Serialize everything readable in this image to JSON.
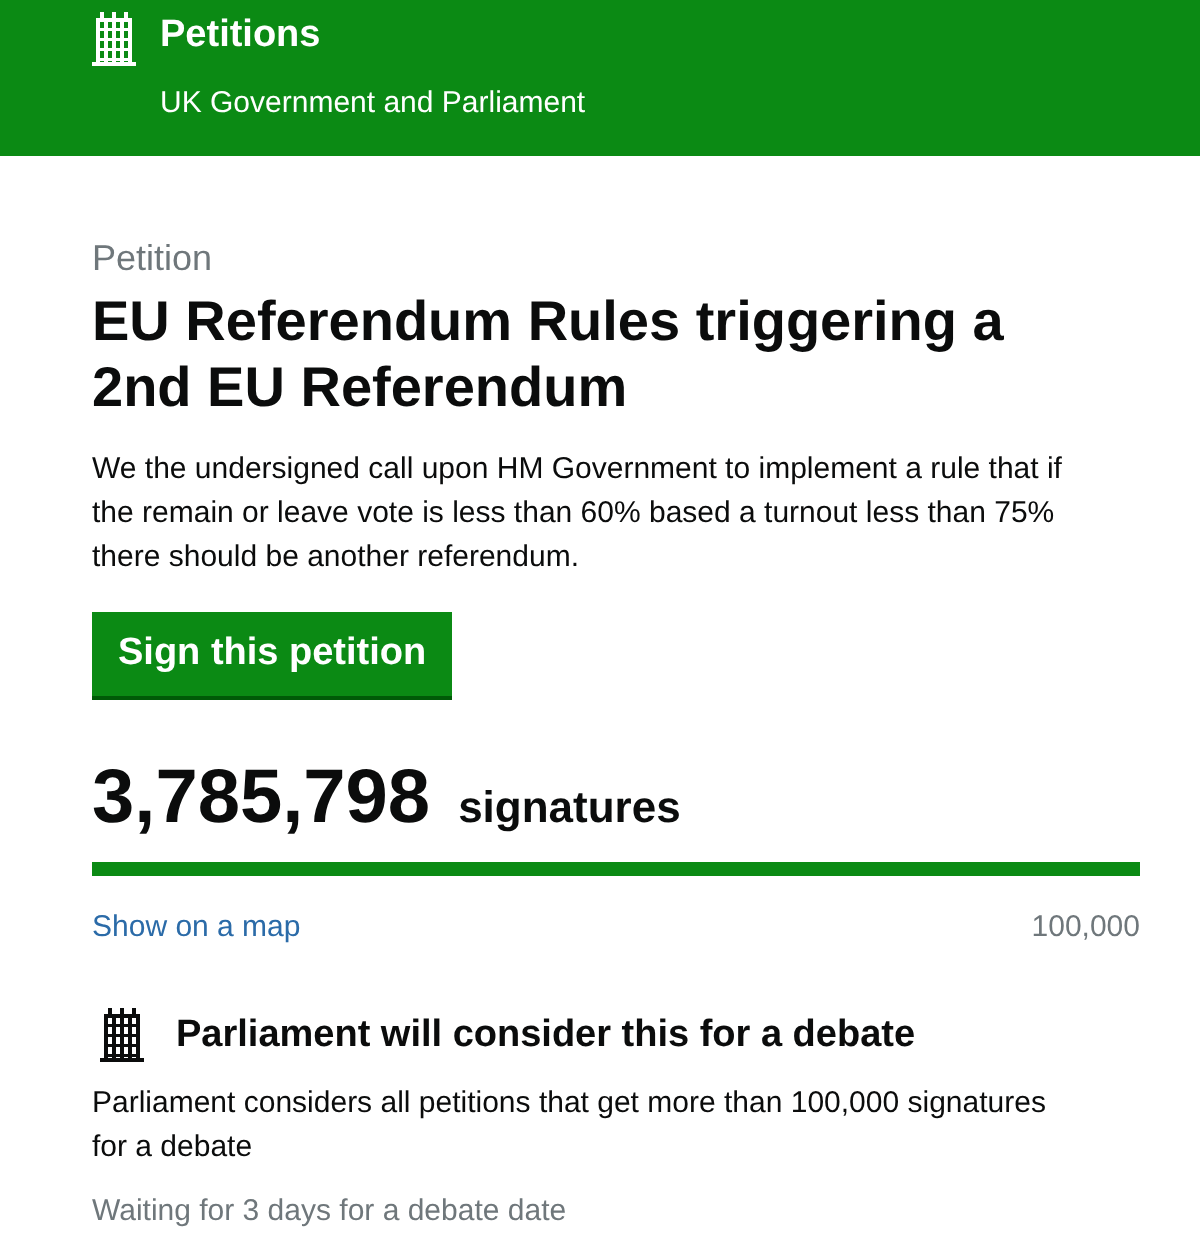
{
  "header": {
    "title": "Petitions",
    "subtitle": "UK Government and Parliament"
  },
  "petition": {
    "label": "Petition",
    "title": "EU Referendum Rules triggering a 2nd EU Referendum",
    "description": "We the undersigned call upon HM Government to implement a rule that if the remain or leave vote is less than 60% based a turnout less than 75% there should be another referendum.",
    "sign_button": "Sign this petition"
  },
  "signatures": {
    "count": "3,785,798",
    "label": "signatures",
    "level": 1,
    "map_link": "Show on a map",
    "threshold": "100,000"
  },
  "debate": {
    "heading": "Parliament will consider this for a debate",
    "text": "Parliament considers all petitions that get more than 100,000 signatures for a debate",
    "status": "Waiting for 3 days for a debate date"
  }
}
